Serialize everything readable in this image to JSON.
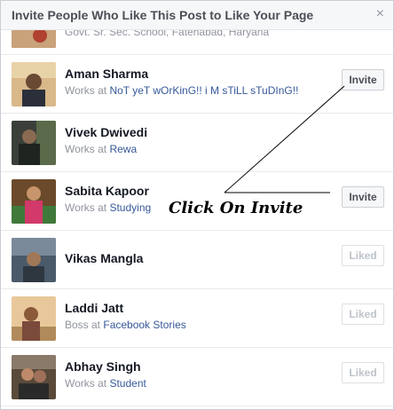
{
  "dialog": {
    "title": "Invite People Who Like This Post to Like Your Page",
    "close_glyph": "×"
  },
  "top_partial": {
    "sub_text": "Govt. Sr. Sec. School, Fatehabad, Haryana"
  },
  "people": [
    {
      "name": "Aman Sharma",
      "prefix": "Works at ",
      "place": "NoT yeT wOrKinG!! i M sTiLL sTuDInG!!",
      "action": "Invite",
      "state": "invite"
    },
    {
      "name": "Vivek Dwivedi",
      "prefix": "Works at ",
      "place": "Rewa",
      "action": "",
      "state": "none"
    },
    {
      "name": "Sabita Kapoor",
      "prefix": "Works at ",
      "place": "Studying",
      "action": "Invite",
      "state": "invite"
    },
    {
      "name": "Vikas Mangla",
      "prefix": "",
      "place": "",
      "action": "Liked",
      "state": "liked"
    },
    {
      "name": "Laddi Jatt",
      "prefix": "Boss at ",
      "place": "Facebook Stories",
      "action": "Liked",
      "state": "liked"
    },
    {
      "name": "Abhay Singh",
      "prefix": "Works at ",
      "place": "Student",
      "action": "Liked",
      "state": "liked"
    }
  ],
  "annotation": {
    "text": "Click On Invite"
  },
  "colors": {
    "link": "#365899",
    "muted": "#90949c",
    "header_bg": "#f6f7f9"
  }
}
